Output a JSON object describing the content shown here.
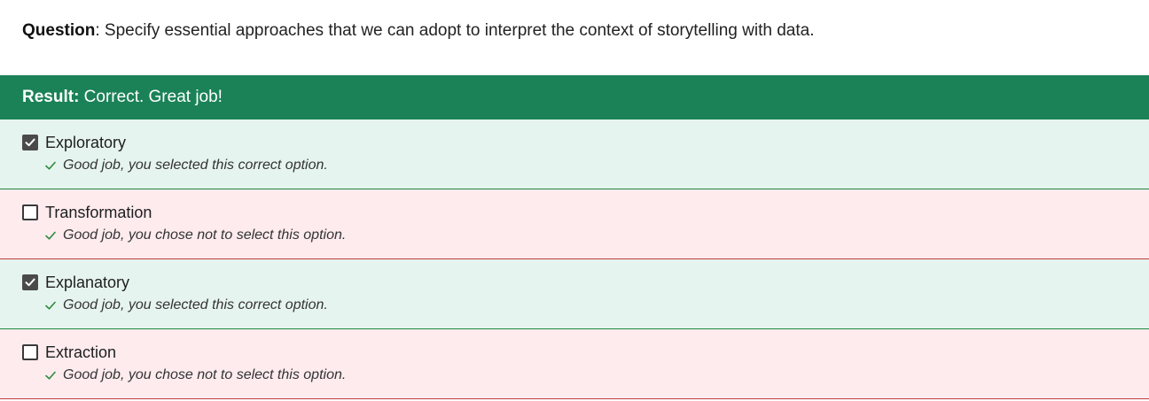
{
  "question": {
    "label": "Question",
    "separator": ":",
    "text": " Specify essential approaches that we can adopt to interpret the context of storytelling with data."
  },
  "result": {
    "label": "Result:",
    "text": " Correct. Great job!",
    "color": "#1b8257"
  },
  "options": [
    {
      "label": "Exploratory",
      "checked": true,
      "feedback": "Good job, you selected this correct option."
    },
    {
      "label": "Transformation",
      "checked": false,
      "feedback": "Good job, you chose not to select this option."
    },
    {
      "label": "Explanatory",
      "checked": true,
      "feedback": "Good job, you selected this correct option."
    },
    {
      "label": "Extraction",
      "checked": false,
      "feedback": "Good job, you chose not to select this option."
    }
  ],
  "icons": {
    "checkbox_checked": "checkbox-checked-icon",
    "checkbox_unchecked": "checkbox-unchecked-icon",
    "feedback_tick": "checkmark-icon"
  },
  "colors": {
    "selected_bg": "#e6f4ef",
    "unselected_bg": "#fdebee",
    "selected_border": "#1b8a3e",
    "unselected_border": "#c23b3b",
    "tick": "#2e8b3e"
  }
}
